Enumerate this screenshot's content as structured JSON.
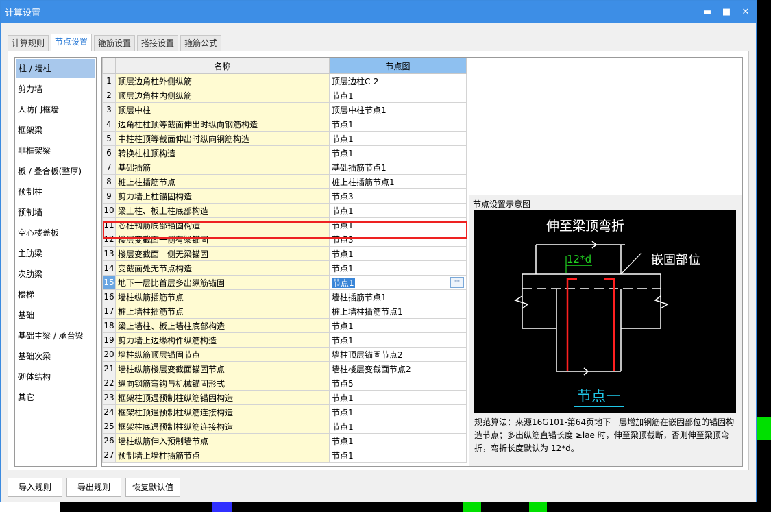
{
  "window": {
    "title": "计算设置"
  },
  "tabs": [
    {
      "label": "计算规则"
    },
    {
      "label": "节点设置"
    },
    {
      "label": "箍筋设置"
    },
    {
      "label": "搭接设置"
    },
    {
      "label": "箍筋公式"
    }
  ],
  "sidebar": {
    "items": [
      {
        "label": "柱 / 墙柱"
      },
      {
        "label": "剪力墙"
      },
      {
        "label": "人防门框墙"
      },
      {
        "label": "框架梁"
      },
      {
        "label": "非框架梁"
      },
      {
        "label": "板 / 叠合板(整厚)"
      },
      {
        "label": "预制柱"
      },
      {
        "label": "预制墙"
      },
      {
        "label": "空心楼盖板"
      },
      {
        "label": "主肋梁"
      },
      {
        "label": "次肋梁"
      },
      {
        "label": "楼梯"
      },
      {
        "label": "基础"
      },
      {
        "label": "基础主梁 / 承台梁"
      },
      {
        "label": "基础次梁"
      },
      {
        "label": "砌体结构"
      },
      {
        "label": "其它"
      }
    ]
  },
  "table": {
    "headers": {
      "name": "名称",
      "diagram": "节点图"
    },
    "rows": [
      {
        "num": "1",
        "name": "顶层边角柱外侧纵筋",
        "value": "顶层边柱C-2"
      },
      {
        "num": "2",
        "name": "顶层边角柱内侧纵筋",
        "value": "节点1"
      },
      {
        "num": "3",
        "name": "顶层中柱",
        "value": "顶层中柱节点1"
      },
      {
        "num": "4",
        "name": "边角柱柱顶等截面伸出时纵向钢筋构造",
        "value": "节点1"
      },
      {
        "num": "5",
        "name": "中柱柱顶等截面伸出时纵向钢筋构造",
        "value": "节点1"
      },
      {
        "num": "6",
        "name": "转换柱柱顶构造",
        "value": "节点1"
      },
      {
        "num": "7",
        "name": "基础插筋",
        "value": "基础插筋节点1"
      },
      {
        "num": "8",
        "name": "桩上柱插筋节点",
        "value": "桩上柱插筋节点1"
      },
      {
        "num": "9",
        "name": "剪力墙上柱锚固构造",
        "value": "节点3"
      },
      {
        "num": "10",
        "name": "梁上柱、板上柱底部构造",
        "value": "节点1"
      },
      {
        "num": "11",
        "name": "芯柱钢筋底部锚固构造",
        "value": "节点1"
      },
      {
        "num": "12",
        "name": "楼层变截面一侧有梁锚固",
        "value": "节点3"
      },
      {
        "num": "13",
        "name": "楼层变截面一侧无梁锚固",
        "value": "节点1"
      },
      {
        "num": "14",
        "name": "变截面处无节点构造",
        "value": "节点1"
      },
      {
        "num": "15",
        "name": "地下一层比首层多出纵筋锚固",
        "value": "节点1"
      },
      {
        "num": "16",
        "name": "墙柱纵筋插筋节点",
        "value": "墙柱插筋节点1"
      },
      {
        "num": "17",
        "name": "桩上墙柱插筋节点",
        "value": "桩上墙柱插筋节点1"
      },
      {
        "num": "18",
        "name": "梁上墙柱、板上墙柱底部构造",
        "value": "节点1"
      },
      {
        "num": "19",
        "name": "剪力墙上边缘构件纵筋构造",
        "value": "节点1"
      },
      {
        "num": "20",
        "name": "墙柱纵筋顶层锚固节点",
        "value": "墙柱顶层锚固节点2"
      },
      {
        "num": "21",
        "name": "墙柱纵筋楼层变截面锚固节点",
        "value": "墙柱楼层变截面节点2"
      },
      {
        "num": "22",
        "name": "纵向钢筋弯钩与机械锚固形式",
        "value": "节点5"
      },
      {
        "num": "23",
        "name": "框架柱顶遇预制柱纵筋锚固构造",
        "value": "节点1"
      },
      {
        "num": "24",
        "name": "框架柱顶遇预制柱纵筋连接构造",
        "value": "节点1"
      },
      {
        "num": "25",
        "name": "框架柱底遇预制柱纵筋连接构造",
        "value": "节点1"
      },
      {
        "num": "26",
        "name": "墙柱纵筋伸入预制墙节点",
        "value": "节点1"
      },
      {
        "num": "27",
        "name": "预制墙上墙柱插筋节点",
        "value": "节点1"
      }
    ],
    "ellipsis": "···"
  },
  "diagram": {
    "title": "节点设置示意图",
    "label_top": "伸至梁顶弯折",
    "label_dim": "12*d",
    "label_right": "嵌固部位",
    "label_bottom": "节点一",
    "description": "规范算法：来源16G101-第64页地下一层增加钢筋在嵌固部位的锚固构造节点；多出纵筋直锚长度 ≥lae 时，伸至梁顶截断，否则伸至梁顶弯折，弯折长度默认为 12*d。"
  },
  "buttons": {
    "import": "导入规则",
    "export": "导出规则",
    "restore": "恢复默认值"
  },
  "colors": {
    "accent": "#3d8ee6",
    "rebar": "#ff2020",
    "dim": "#20d020",
    "label": "#20c8e8"
  }
}
